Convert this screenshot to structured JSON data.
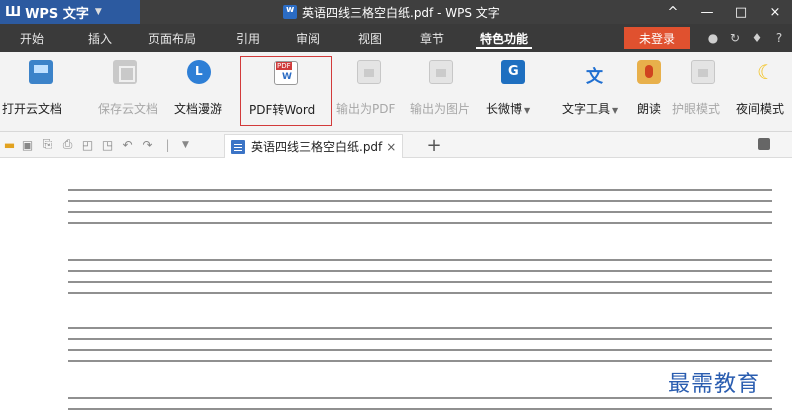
{
  "titlebar": {
    "app_name": "WPS 文字",
    "doc_title": "英语四线三格空白纸.pdf - WPS 文字",
    "controls": [
      "^",
      "—",
      "□",
      "×"
    ]
  },
  "menu": {
    "items": [
      "开始",
      "插入",
      "页面布局",
      "引用",
      "审阅",
      "视图",
      "章节",
      "特色功能"
    ],
    "active": "特色功能",
    "login": "未登录"
  },
  "ribbon": {
    "buttons": [
      {
        "label": "打开云文档",
        "icon": "open-cloud-icon",
        "enabled": true
      },
      {
        "label": "保存云文档",
        "icon": "save-cloud-icon",
        "enabled": false
      },
      {
        "label": "文档漫游",
        "icon": "roaming-icon",
        "enabled": true
      },
      {
        "label": "PDF转Word",
        "icon": "pdf-to-word-icon",
        "enabled": true
      },
      {
        "label": "输出为PDF",
        "icon": "export-pdf-icon",
        "enabled": false
      },
      {
        "label": "输出为图片",
        "icon": "export-image-icon",
        "enabled": false
      },
      {
        "label": "长微博",
        "icon": "long-weibo-icon",
        "enabled": true
      },
      {
        "label": "文字工具",
        "icon": "text-tool-icon",
        "enabled": true
      },
      {
        "label": "朗读",
        "icon": "read-aloud-icon",
        "enabled": true
      },
      {
        "label": "护眼模式",
        "icon": "eye-care-icon",
        "enabled": false
      },
      {
        "label": "夜间模式",
        "icon": "night-mode-icon",
        "enabled": true
      }
    ]
  },
  "tabs": {
    "document": "英语四线三格空白纸.pdf",
    "close": "×",
    "add": "+"
  },
  "document": {
    "line_groups": 4,
    "watermark": "最需教育"
  },
  "colors": {
    "accent": "#e0512f",
    "menubar": "#3a3a3a",
    "highlight_border": "#d23a3a"
  }
}
